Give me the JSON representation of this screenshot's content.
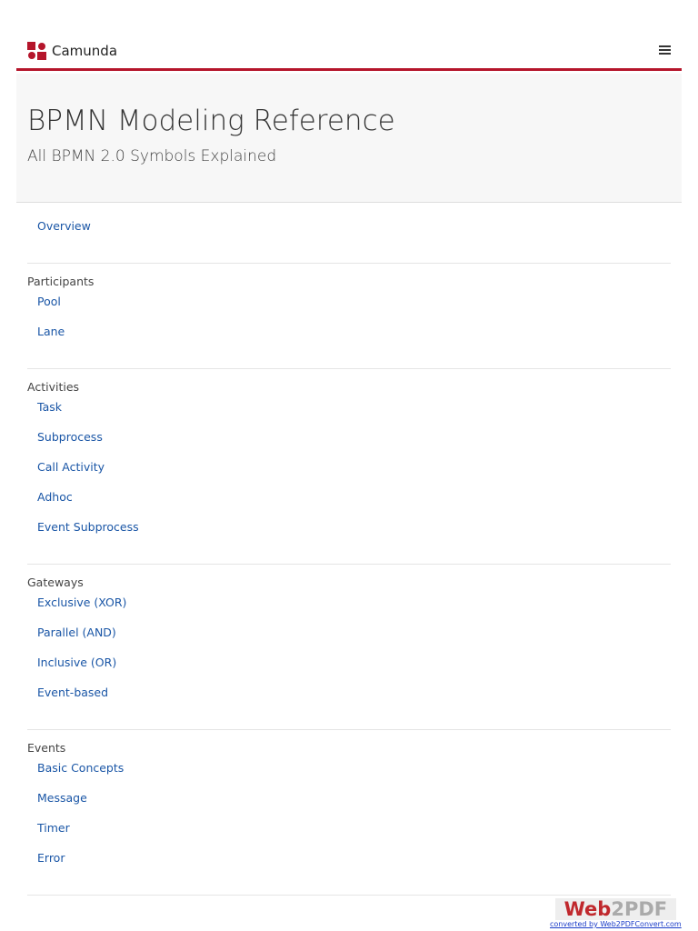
{
  "header": {
    "brand": "Camunda",
    "menu_icon": "hamburger-icon"
  },
  "hero": {
    "title": "BPMN Modeling Reference",
    "subtitle": "All BPMN 2.0 Symbols Explained"
  },
  "nav": [
    {
      "heading": null,
      "items": [
        "Overview"
      ]
    },
    {
      "heading": "Participants",
      "items": [
        "Pool",
        "Lane"
      ]
    },
    {
      "heading": "Activities",
      "items": [
        "Task",
        "Subprocess",
        "Call Activity",
        "Adhoc",
        "Event Subprocess"
      ]
    },
    {
      "heading": "Gateways",
      "items": [
        "Exclusive (XOR)",
        "Parallel (AND)",
        "Inclusive (OR)",
        "Event-based"
      ]
    },
    {
      "heading": "Events",
      "items": [
        "Basic Concepts",
        "Message",
        "Timer",
        "Error"
      ]
    }
  ],
  "watermark": {
    "logo_a": "Web",
    "logo_b": "2PDF",
    "caption": "converted by Web2PDFConvert.com"
  }
}
